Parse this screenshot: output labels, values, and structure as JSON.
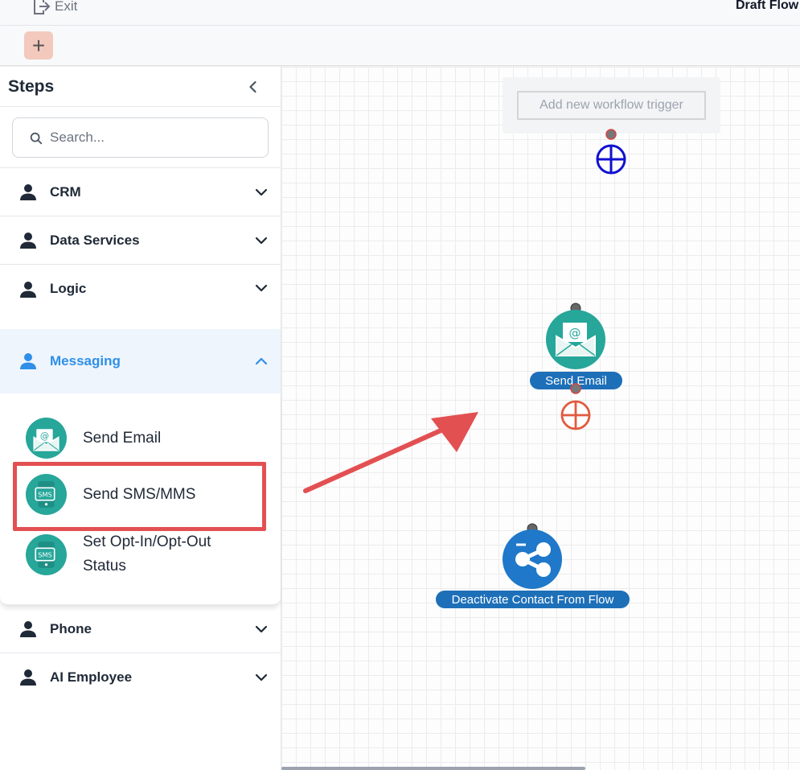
{
  "topbar": {
    "exit_label": "Exit",
    "flow_title": "Draft Flow"
  },
  "toolbar": {
    "add_label": "+"
  },
  "sidebar": {
    "title": "Steps",
    "search_placeholder": "Search...",
    "categories": [
      {
        "label": "CRM"
      },
      {
        "label": "Data Services"
      },
      {
        "label": "Logic"
      },
      {
        "label": "Messaging"
      },
      {
        "label": "Phone"
      },
      {
        "label": "AI Employee"
      }
    ],
    "messaging_items": [
      {
        "label": "Send Email",
        "icon": "email-icon"
      },
      {
        "label": "Send SMS/MMS",
        "icon": "sms-icon"
      },
      {
        "label": "Set Opt-In/Opt-Out Status",
        "icon": "sms-icon"
      }
    ]
  },
  "canvas": {
    "trigger_label": "Add new workflow trigger",
    "nodes": [
      {
        "label": "Send Email",
        "icon": "email-icon"
      },
      {
        "label": "Deactivate Contact From Flow",
        "icon": "share-icon"
      }
    ]
  },
  "colors": {
    "accent_blue": "#2f8fe8",
    "node_label_bg": "#1d6fb8",
    "teal": "#27a69a",
    "highlight_red": "#e35052",
    "add_button_bg": "#f3c9bd"
  }
}
